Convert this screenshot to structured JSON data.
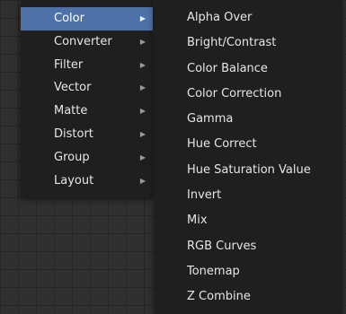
{
  "main_menu": {
    "items": [
      {
        "label": "Color",
        "active": true
      },
      {
        "label": "Converter",
        "active": false
      },
      {
        "label": "Filter",
        "active": false
      },
      {
        "label": "Vector",
        "active": false
      },
      {
        "label": "Matte",
        "active": false
      },
      {
        "label": "Distort",
        "active": false
      },
      {
        "label": "Group",
        "active": false
      },
      {
        "label": "Layout",
        "active": false
      }
    ],
    "submenu_arrow_glyph": "▶"
  },
  "submenu": {
    "items": [
      {
        "label": "Alpha Over"
      },
      {
        "label": "Bright/Contrast"
      },
      {
        "label": "Color Balance"
      },
      {
        "label": "Color Correction"
      },
      {
        "label": "Gamma"
      },
      {
        "label": "Hue Correct"
      },
      {
        "label": "Hue Saturation Value"
      },
      {
        "label": "Invert"
      },
      {
        "label": "Mix"
      },
      {
        "label": "RGB Curves"
      },
      {
        "label": "Tonemap"
      },
      {
        "label": "Z Combine"
      }
    ]
  },
  "colors": {
    "background": "#303030",
    "menu_background": "#1f1f1f",
    "highlight": "#4e72a8",
    "text": "#e6e6e6"
  }
}
